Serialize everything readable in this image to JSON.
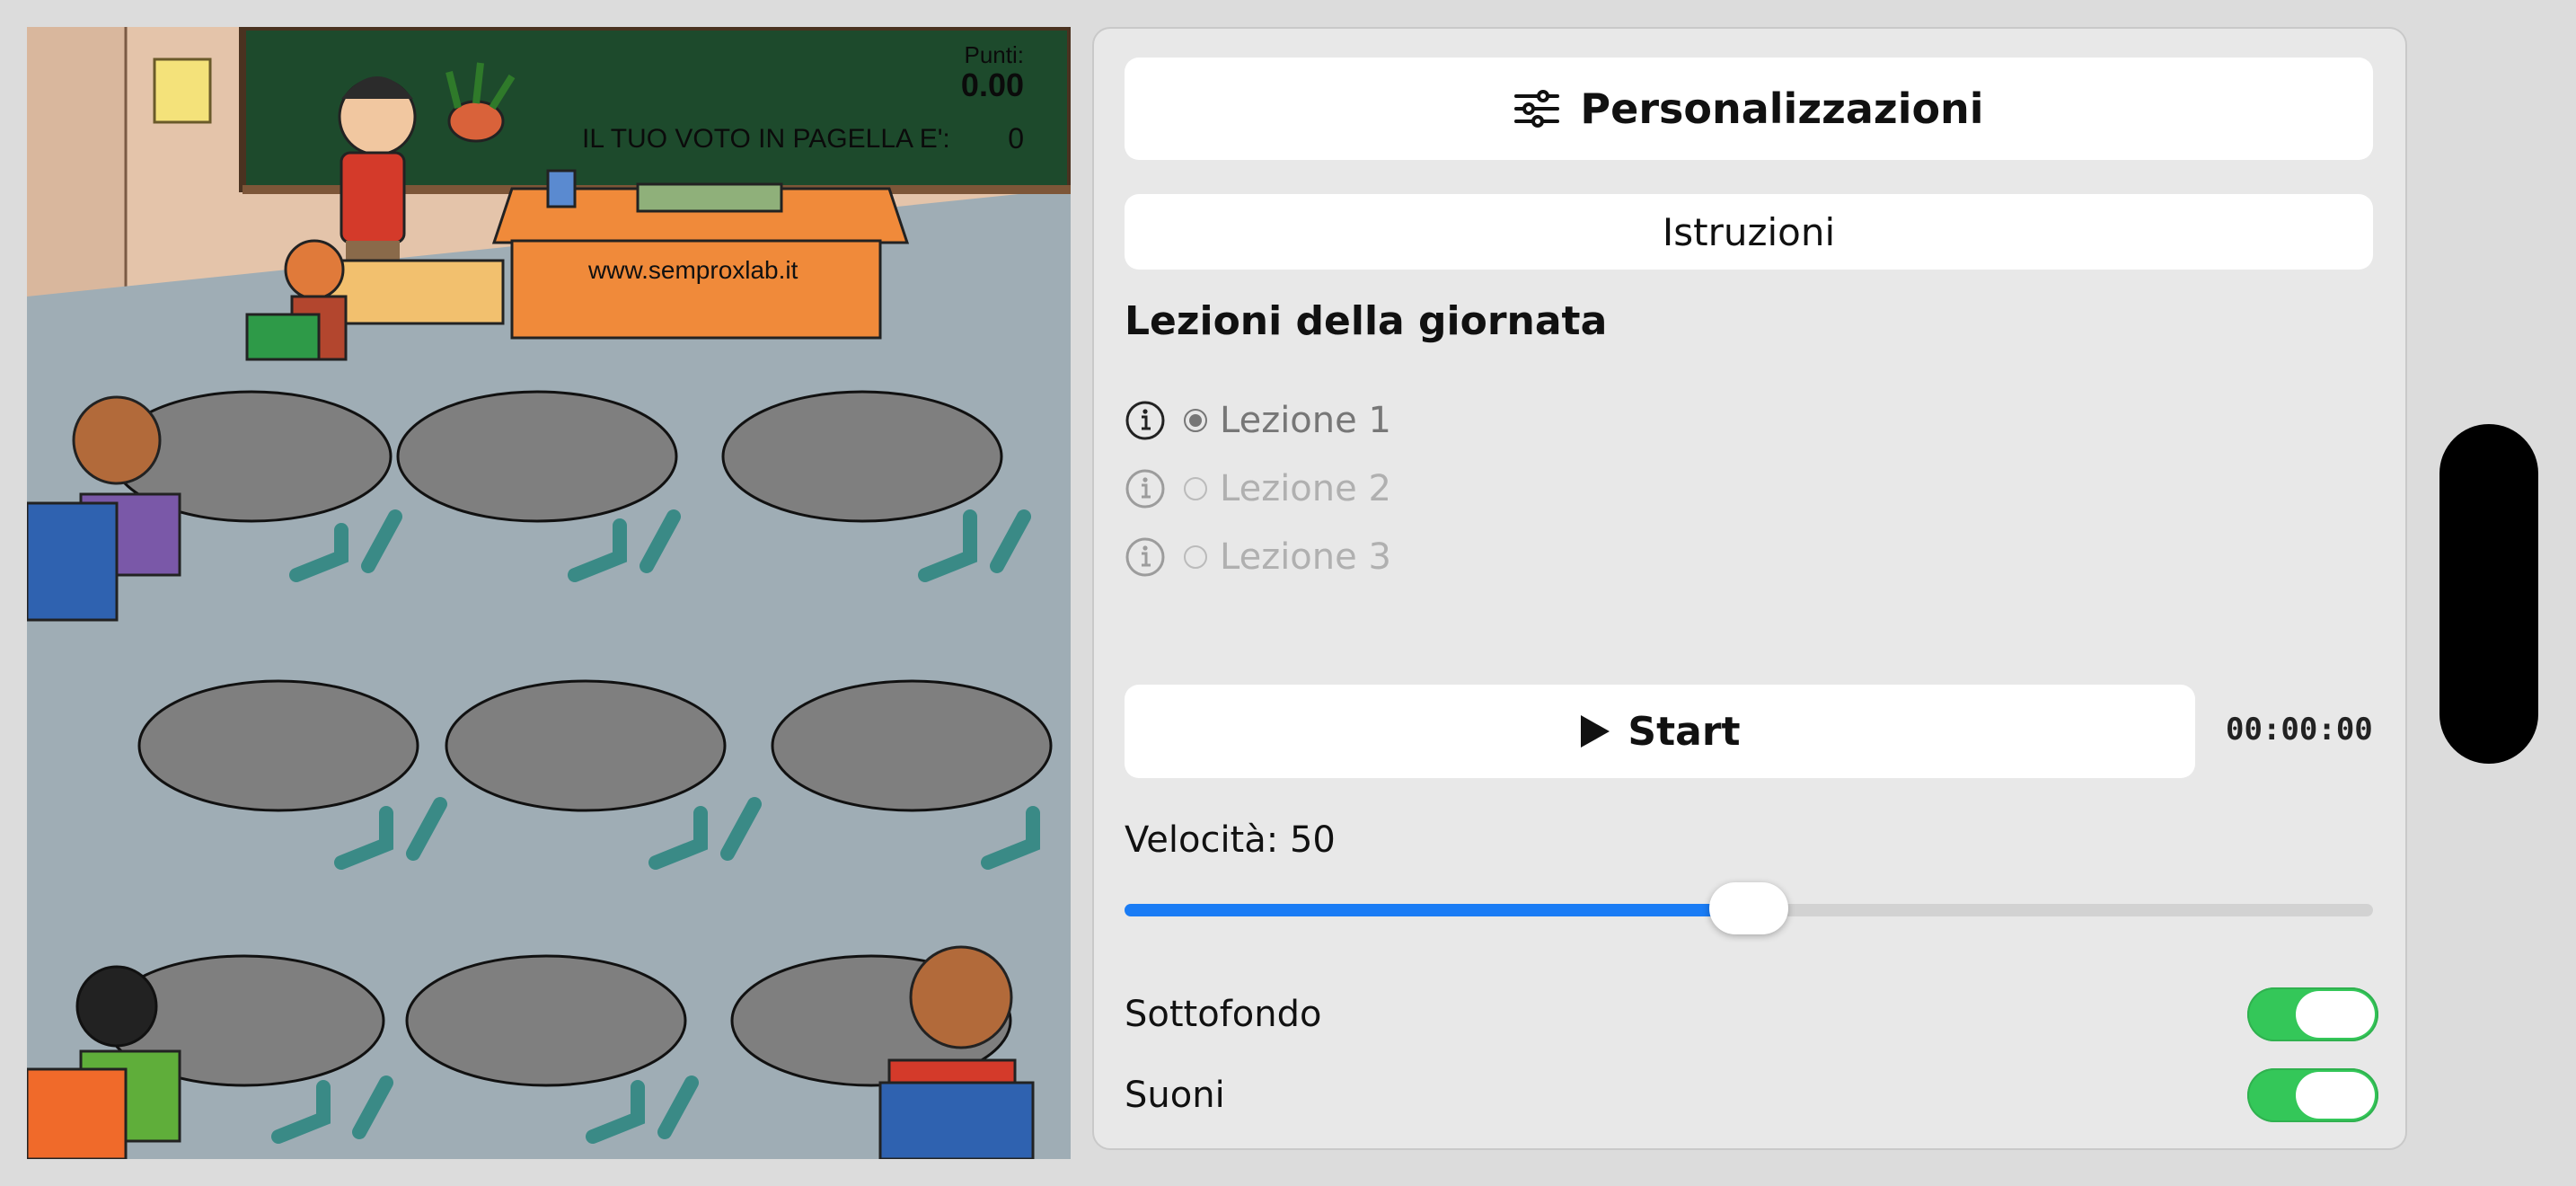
{
  "scene": {
    "points_label": "Punti:",
    "points_value": "0.00",
    "grade_label": "IL TUO VOTO IN PAGELLA E':",
    "grade_value": "0",
    "website": "www.semproxlab.it"
  },
  "panel": {
    "customize_label": "Personalizzazioni",
    "instructions_label": "Istruzioni",
    "lessons_title": "Lezioni della giornata",
    "lessons": [
      {
        "label": "Lezione 1",
        "selected": true,
        "enabled": true
      },
      {
        "label": "Lezione 2",
        "selected": false,
        "enabled": false
      },
      {
        "label": "Lezione 3",
        "selected": false,
        "enabled": false
      }
    ],
    "start_label": "Start",
    "timer": "00:00:00",
    "speed_label": "Velocità: 50",
    "speed_value": 50,
    "speed_max": 100,
    "background_music_label": "Sottofondo",
    "background_music_on": true,
    "sounds_label": "Suoni",
    "sounds_on": true
  },
  "colors": {
    "accent": "#1a7cf5",
    "toggle_on": "#34c759",
    "chalkboard": "#1d4a2c",
    "floor": "#9fadb5"
  }
}
